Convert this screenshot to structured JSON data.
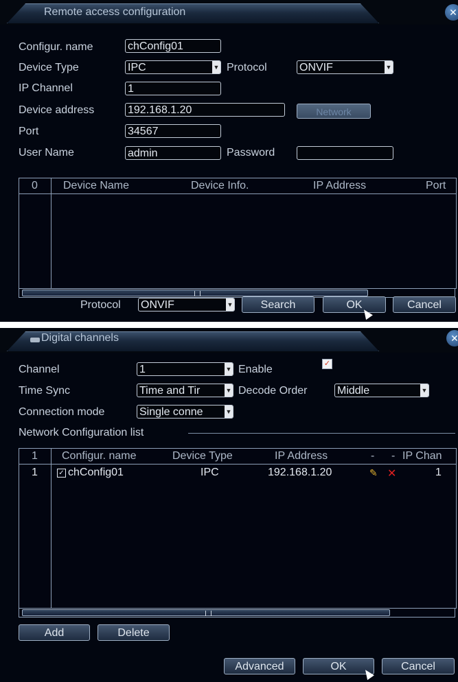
{
  "remote": {
    "title": "Remote access configuration",
    "close_icon": "close-icon",
    "labels": {
      "config_name": "Configur. name",
      "device_type": "Device Type",
      "protocol": "Protocol",
      "ip_channel": "IP Channel",
      "device_address": "Device address",
      "port": "Port",
      "user_name": "User Name",
      "password": "Password",
      "bottom_protocol": "Protocol"
    },
    "values": {
      "config_name": "chConfig01",
      "device_type": "IPC",
      "protocol": "ONVIF",
      "ip_channel": "1",
      "device_address": "192.168.1.20",
      "port": "34567",
      "user_name": "admin",
      "password": "",
      "bottom_protocol": "ONVIF"
    },
    "network_button": "Network",
    "list": {
      "count": "0",
      "columns": [
        "Device Name",
        "Device Info.",
        "IP Address",
        "Port"
      ],
      "rows": []
    },
    "buttons": {
      "search": "Search",
      "ok": "OK",
      "cancel": "Cancel"
    }
  },
  "digital": {
    "title": "Digital channels",
    "title_icon": "camera-icon",
    "close_icon": "close-icon",
    "labels": {
      "channel": "Channel",
      "enable": "Enable",
      "time_sync": "Time Sync",
      "decode_order": "Decode Order",
      "connection_mode": "Connection mode",
      "group": "Network Configuration list"
    },
    "values": {
      "channel": "1",
      "enable": true,
      "time_sync": "Time and Tir",
      "decode_order": "Middle",
      "connection_mode": "Single conne"
    },
    "list": {
      "count": "1",
      "columns": [
        "Configur. name",
        "Device Type",
        "IP Address",
        "-",
        "-",
        "IP Chan"
      ],
      "rows": [
        {
          "index": "1",
          "checked": true,
          "name": "chConfig01",
          "type": "IPC",
          "ip": "192.168.1.20",
          "edit_icon": "pencil-icon",
          "delete_icon": "delete-x-icon",
          "ip_channel": "1"
        }
      ]
    },
    "buttons": {
      "add": "Add",
      "delete": "Delete",
      "advanced": "Advanced",
      "ok": "OK",
      "cancel": "Cancel"
    }
  },
  "colors": {
    "background": "#020610",
    "border": "#8ea0b8",
    "text": "#c9d2de",
    "delete": "#e02020",
    "edit": "#e0b030"
  }
}
